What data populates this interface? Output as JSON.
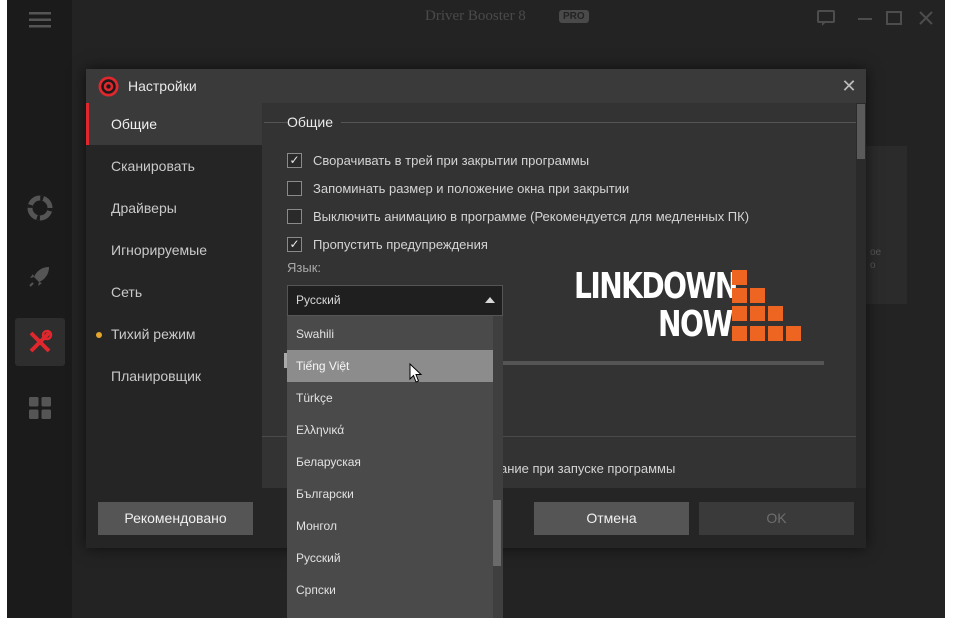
{
  "app": {
    "title": "Driver Booster 8",
    "badge": "PRO",
    "bg_card_text": "ое\nо"
  },
  "rail": {
    "icons": [
      "menu-icon",
      "lifebuoy-icon",
      "rocket-icon",
      "tools-icon",
      "grid-icon"
    ]
  },
  "dialog": {
    "title": "Настройки",
    "close": "✕",
    "nav": [
      {
        "label": "Общие",
        "active": true
      },
      {
        "label": "Сканировать"
      },
      {
        "label": "Драйверы"
      },
      {
        "label": "Игнорируемые"
      },
      {
        "label": "Сеть"
      },
      {
        "label": "Тихий режим",
        "dot": true
      },
      {
        "label": "Планировщик"
      }
    ],
    "section_title": "Общие",
    "checkboxes": [
      {
        "label": "Сворачивать в трей при закрытии программы",
        "checked": true
      },
      {
        "label": "Запоминать размер и положение окна при закрытии",
        "checked": false
      },
      {
        "label": "Выключить анимацию в программе (Рекомендуется для медленных ПК)",
        "checked": false
      },
      {
        "label": "Пропустить предупреждения",
        "checked": true
      }
    ],
    "language_label": "Язык:",
    "language_value": "Русский",
    "bottom_text": "ование при запуске программы",
    "buttons": {
      "recommended": "Рекомендовано",
      "cancel": "Отмена",
      "ok": "OK"
    }
  },
  "dropdown": {
    "items": [
      "Swahili",
      "Tiếng Việt",
      "Türkçe",
      "Ελληνικά",
      "Беларуская",
      "Български",
      "Монгол",
      "Русский",
      "Српски"
    ],
    "hovered": "Tiếng Việt"
  },
  "watermark": {
    "line1": "LINKDOWN",
    "line2": "NOW",
    "color": "#ee6522"
  },
  "colors": {
    "accent": "#e0272d",
    "dot": "#e6a52c"
  }
}
